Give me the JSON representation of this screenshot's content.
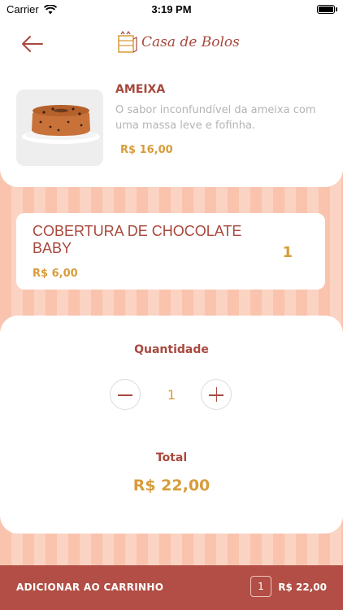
{
  "status": {
    "carrier": "Carrier",
    "time": "3:19 PM"
  },
  "header": {
    "logo_text": "Casa de Bolos"
  },
  "product": {
    "name": "AMEIXA",
    "description": "O sabor inconfundível da ameixa com uma massa leve e fofinha.",
    "price": "R$ 16,00"
  },
  "addon": {
    "name": "COBERTURA DE CHOCOLATE BABY",
    "price": "R$ 6,00",
    "count": "1"
  },
  "quantity": {
    "label": "Quantidade",
    "value": "1"
  },
  "total": {
    "label": "Total",
    "value": "R$ 22,00"
  },
  "cart_bar": {
    "label": "ADICIONAR AO CARRINHO",
    "count": "1",
    "total": "R$ 22,00"
  },
  "colors": {
    "brand": "#a8483d",
    "accent": "#d89c3b",
    "bar": "#b24e45"
  }
}
